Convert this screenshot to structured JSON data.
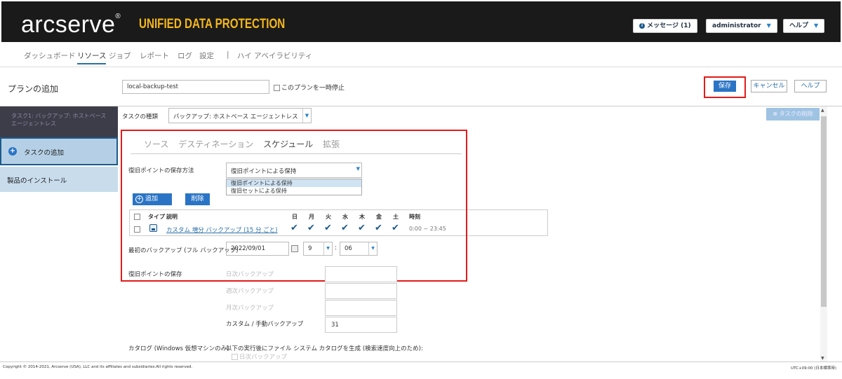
{
  "header": {
    "logo": "arcserve",
    "logo_mark": "®",
    "product": "UNIFIED DATA PROTECTION",
    "messages": "メッセージ (1)",
    "user": "administrator",
    "help": "ヘルプ"
  },
  "nav": {
    "items": [
      "ダッシュボード",
      "リソース",
      "ジョブ",
      "レポート",
      "ログ",
      "設定",
      "|",
      "ハイ アベイラビリティ"
    ],
    "active": "リソース"
  },
  "plan": {
    "title": "プランの追加",
    "name_value": "local-backup-test",
    "pause_label": "このプランを一時停止",
    "save": "保存",
    "cancel": "キャンセル",
    "help": "ヘルプ"
  },
  "sidebar": {
    "task": "タスク1: バックアップ: ホストベース エージェントレス",
    "add_task": "タスクの追加",
    "install": "製品のインストール"
  },
  "task": {
    "type_label": "タスクの種類",
    "type_value": "バックアップ: ホストベース エージェントレス",
    "delete_task": "タスクの削除"
  },
  "tabs": [
    "ソース",
    "デスティネーション",
    "スケジュール",
    "拡張"
  ],
  "active_tab": "スケジュール",
  "retention": {
    "label": "復旧ポイントの保存方法",
    "selected": "復旧ポイントによる保持",
    "options": [
      "復旧ポイントによる保持",
      "復旧セットによる保持"
    ]
  },
  "buttons": {
    "add": "追加",
    "delete": "削除"
  },
  "schedule_table": {
    "headers": {
      "type": "タイプ",
      "desc": "説明",
      "sun": "日",
      "mon": "月",
      "tue": "火",
      "wed": "水",
      "thu": "木",
      "fri": "金",
      "sat": "土",
      "time": "時刻"
    },
    "row": {
      "desc": "カスタム 増分 バックアップ (15 分 ごと)",
      "time": "0:00 ~ 23:45"
    }
  },
  "first_backup": {
    "label": "最初のバックアップ (フル バックアップ)",
    "date": "2022/09/01",
    "hour": "9",
    "minute": "06"
  },
  "recovery_save": {
    "label": "復旧ポイントの保存",
    "daily": "日次バックアップ",
    "weekly": "週次バックアップ",
    "monthly": "月次バックアップ",
    "custom": "カスタム / 手動バックアップ",
    "custom_value": "31"
  },
  "catalog": {
    "label": "カタログ (Windows 仮想マシンのみ)",
    "desc": "以下の実行後にファイル システム カタログを生成 (検索速度向上のため):",
    "daily": "日次バックアップ"
  },
  "footer": {
    "copyright": "Copyright © 2014-2021, Arcserve (USA), LLC and its affiliates and subsidiaries.All rights reserved.",
    "timezone": "UTC+09:00 (日本標準時)"
  }
}
